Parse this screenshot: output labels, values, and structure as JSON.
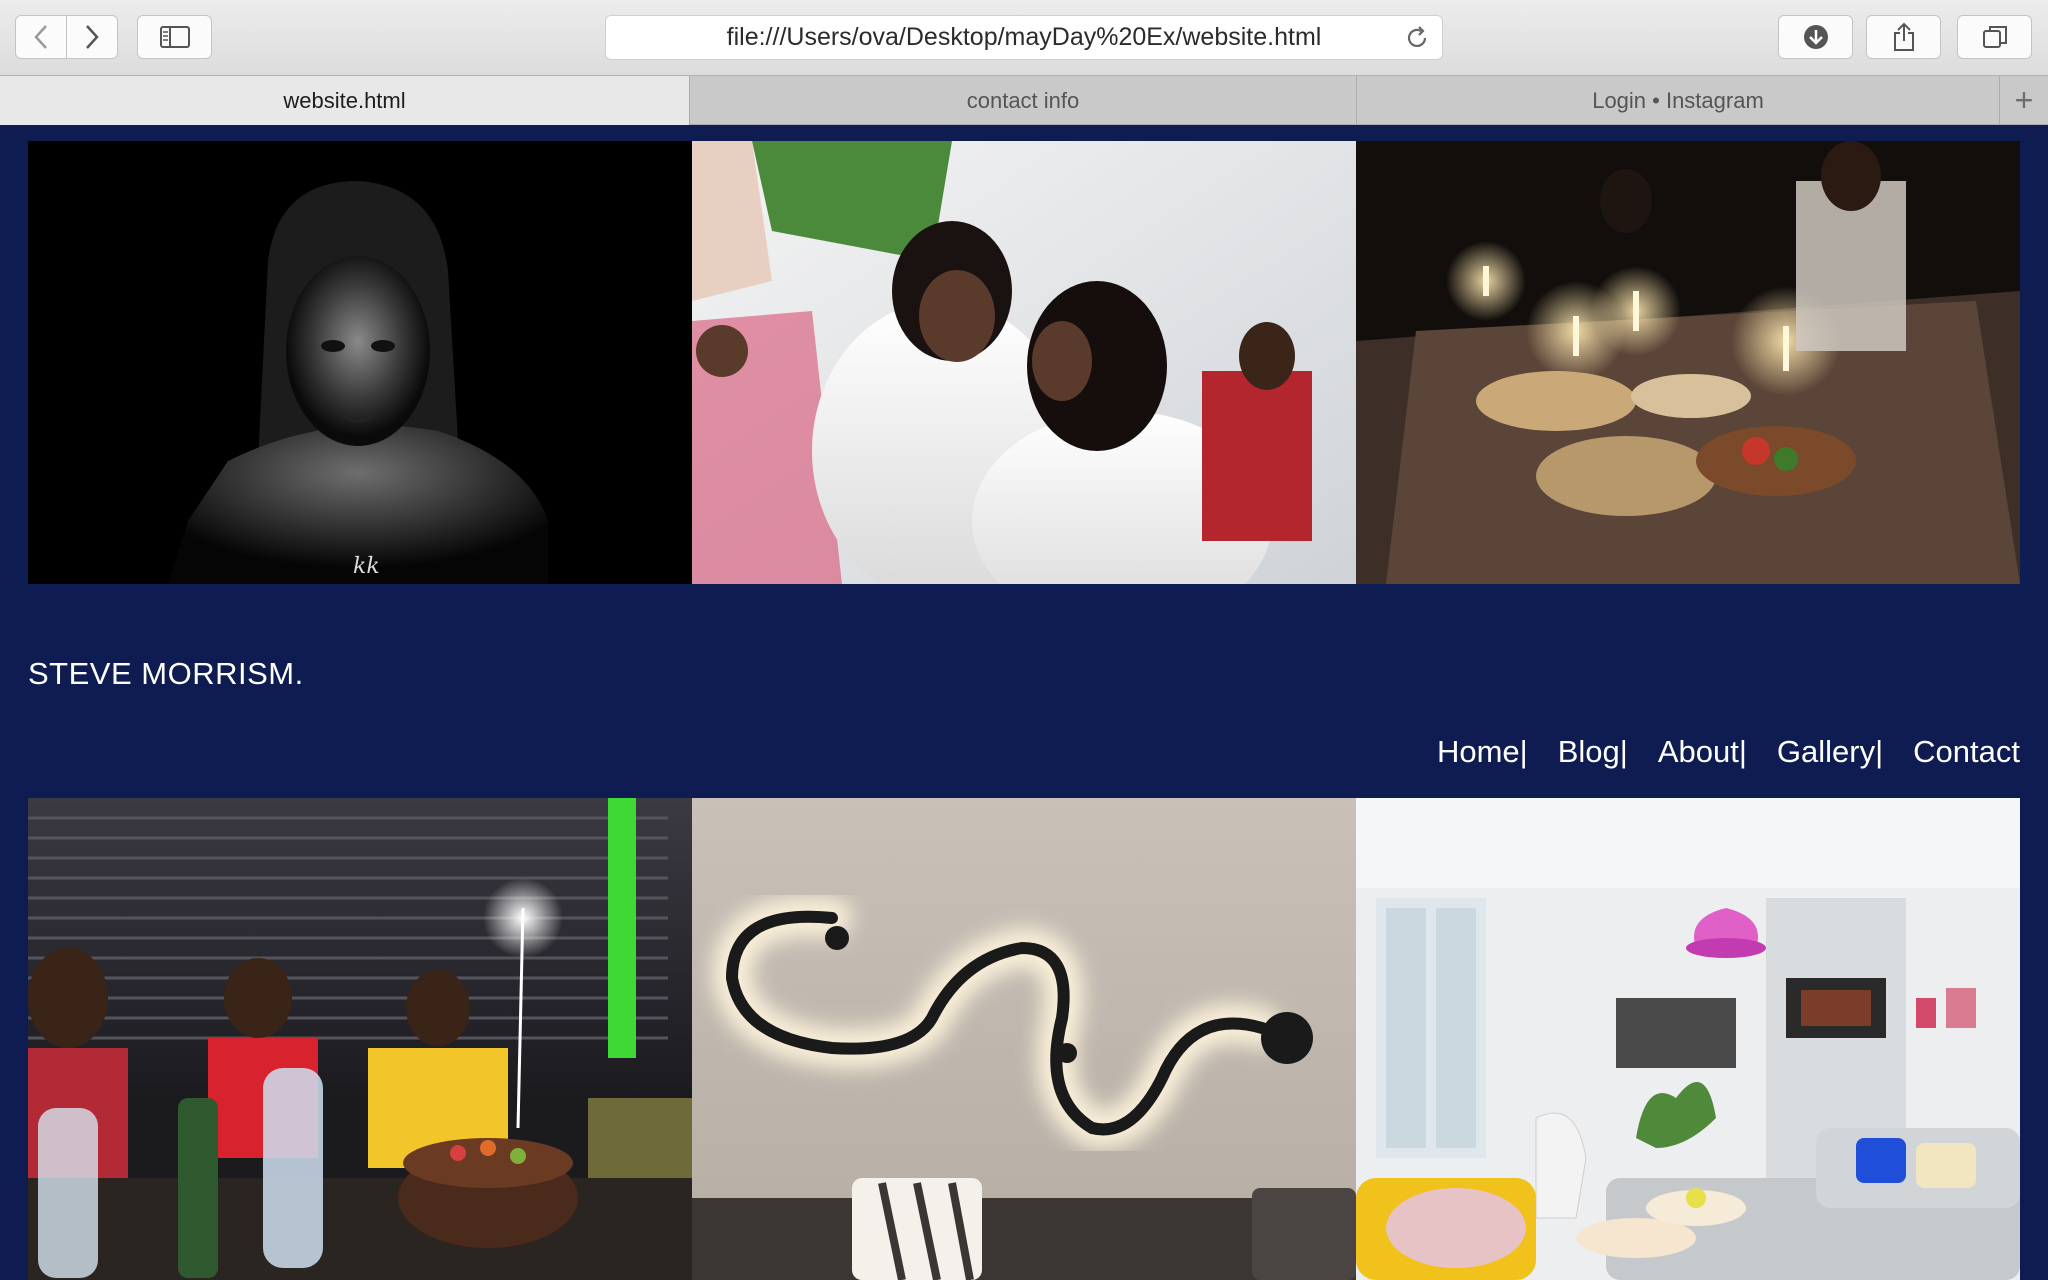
{
  "browser": {
    "url": "file:///Users/ova/Desktop/mayDay%20Ex/website.html",
    "tabs": [
      {
        "label": "website.html",
        "active": true
      },
      {
        "label": "contact info",
        "active": false
      },
      {
        "label": "Login • Instagram",
        "active": false
      }
    ],
    "new_tab_symbol": "+"
  },
  "site": {
    "title": "STEVE MORRISM.",
    "nav": [
      {
        "label": "Home",
        "sep": "|"
      },
      {
        "label": "Blog",
        "sep": "|"
      },
      {
        "label": "About",
        "sep": "|"
      },
      {
        "label": "Gallery",
        "sep": "|"
      },
      {
        "label": "Contact",
        "sep": ""
      }
    ],
    "signature": "kk"
  },
  "colors": {
    "page_background": "#0f1c52",
    "nav_text": "#ffffff"
  },
  "gallery_top": [
    {
      "subject": "black-and-white portrait of a woman with braids"
    },
    {
      "subject": "two women in white lace dresses at an outdoor celebration"
    },
    {
      "subject": "candlelit dinner table with food and guests"
    }
  ],
  "gallery_bottom": [
    {
      "subject": "birthday celebration with cake and sparklers"
    },
    {
      "subject": "curved LED wall light above a sofa"
    },
    {
      "subject": "bright living room with pink pendant lamp"
    }
  ]
}
